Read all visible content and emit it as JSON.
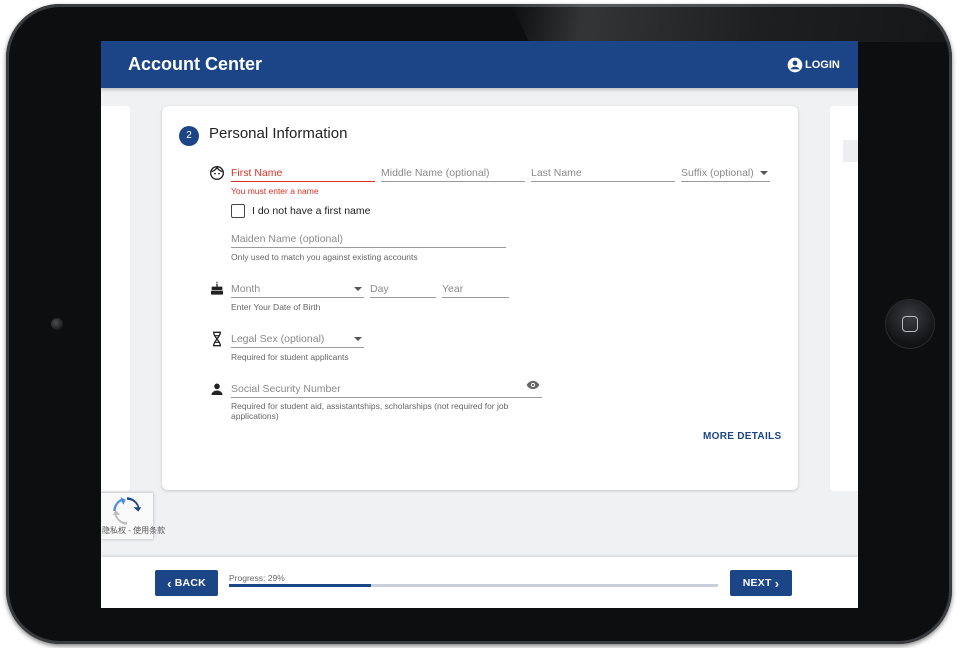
{
  "app": {
    "title": "Account Center",
    "login_label": "LOGIN",
    "accent_color": "#1c4587"
  },
  "section": {
    "step": "2",
    "title": "Personal Information"
  },
  "name": {
    "first_placeholder": "First Name",
    "first_error": "You must enter a name",
    "middle_placeholder": "Middle Name (optional)",
    "last_placeholder": "Last Name",
    "suffix_placeholder": "Suffix (optional)",
    "no_first_name_label": "I do not have a first name",
    "maiden_placeholder": "Maiden Name (optional)",
    "maiden_helper": "Only used to match you against existing accounts"
  },
  "dob": {
    "month_placeholder": "Month",
    "day_placeholder": "Day",
    "year_placeholder": "Year",
    "helper": "Enter Your Date of Birth"
  },
  "sex": {
    "placeholder": "Legal Sex (optional)",
    "helper": "Required for student applicants"
  },
  "ssn": {
    "placeholder": "Social Security Number",
    "helper": "Required for student aid, assistantships, scholarships (not required for job applications)"
  },
  "more_details_label": "MORE DETAILS",
  "recaptcha": {
    "text": "隐私权 - 使用条款"
  },
  "footer": {
    "back_label": "BACK",
    "next_label": "NEXT",
    "progress_label": "Progress: 29%",
    "progress_value": 29
  },
  "icons": {
    "name_row": "face-icon",
    "dob_row": "cake-icon",
    "sex_row": "dna-icon",
    "ssn_row": "person-icon",
    "ssn_toggle": "eye-icon",
    "login": "account-circle-icon"
  }
}
